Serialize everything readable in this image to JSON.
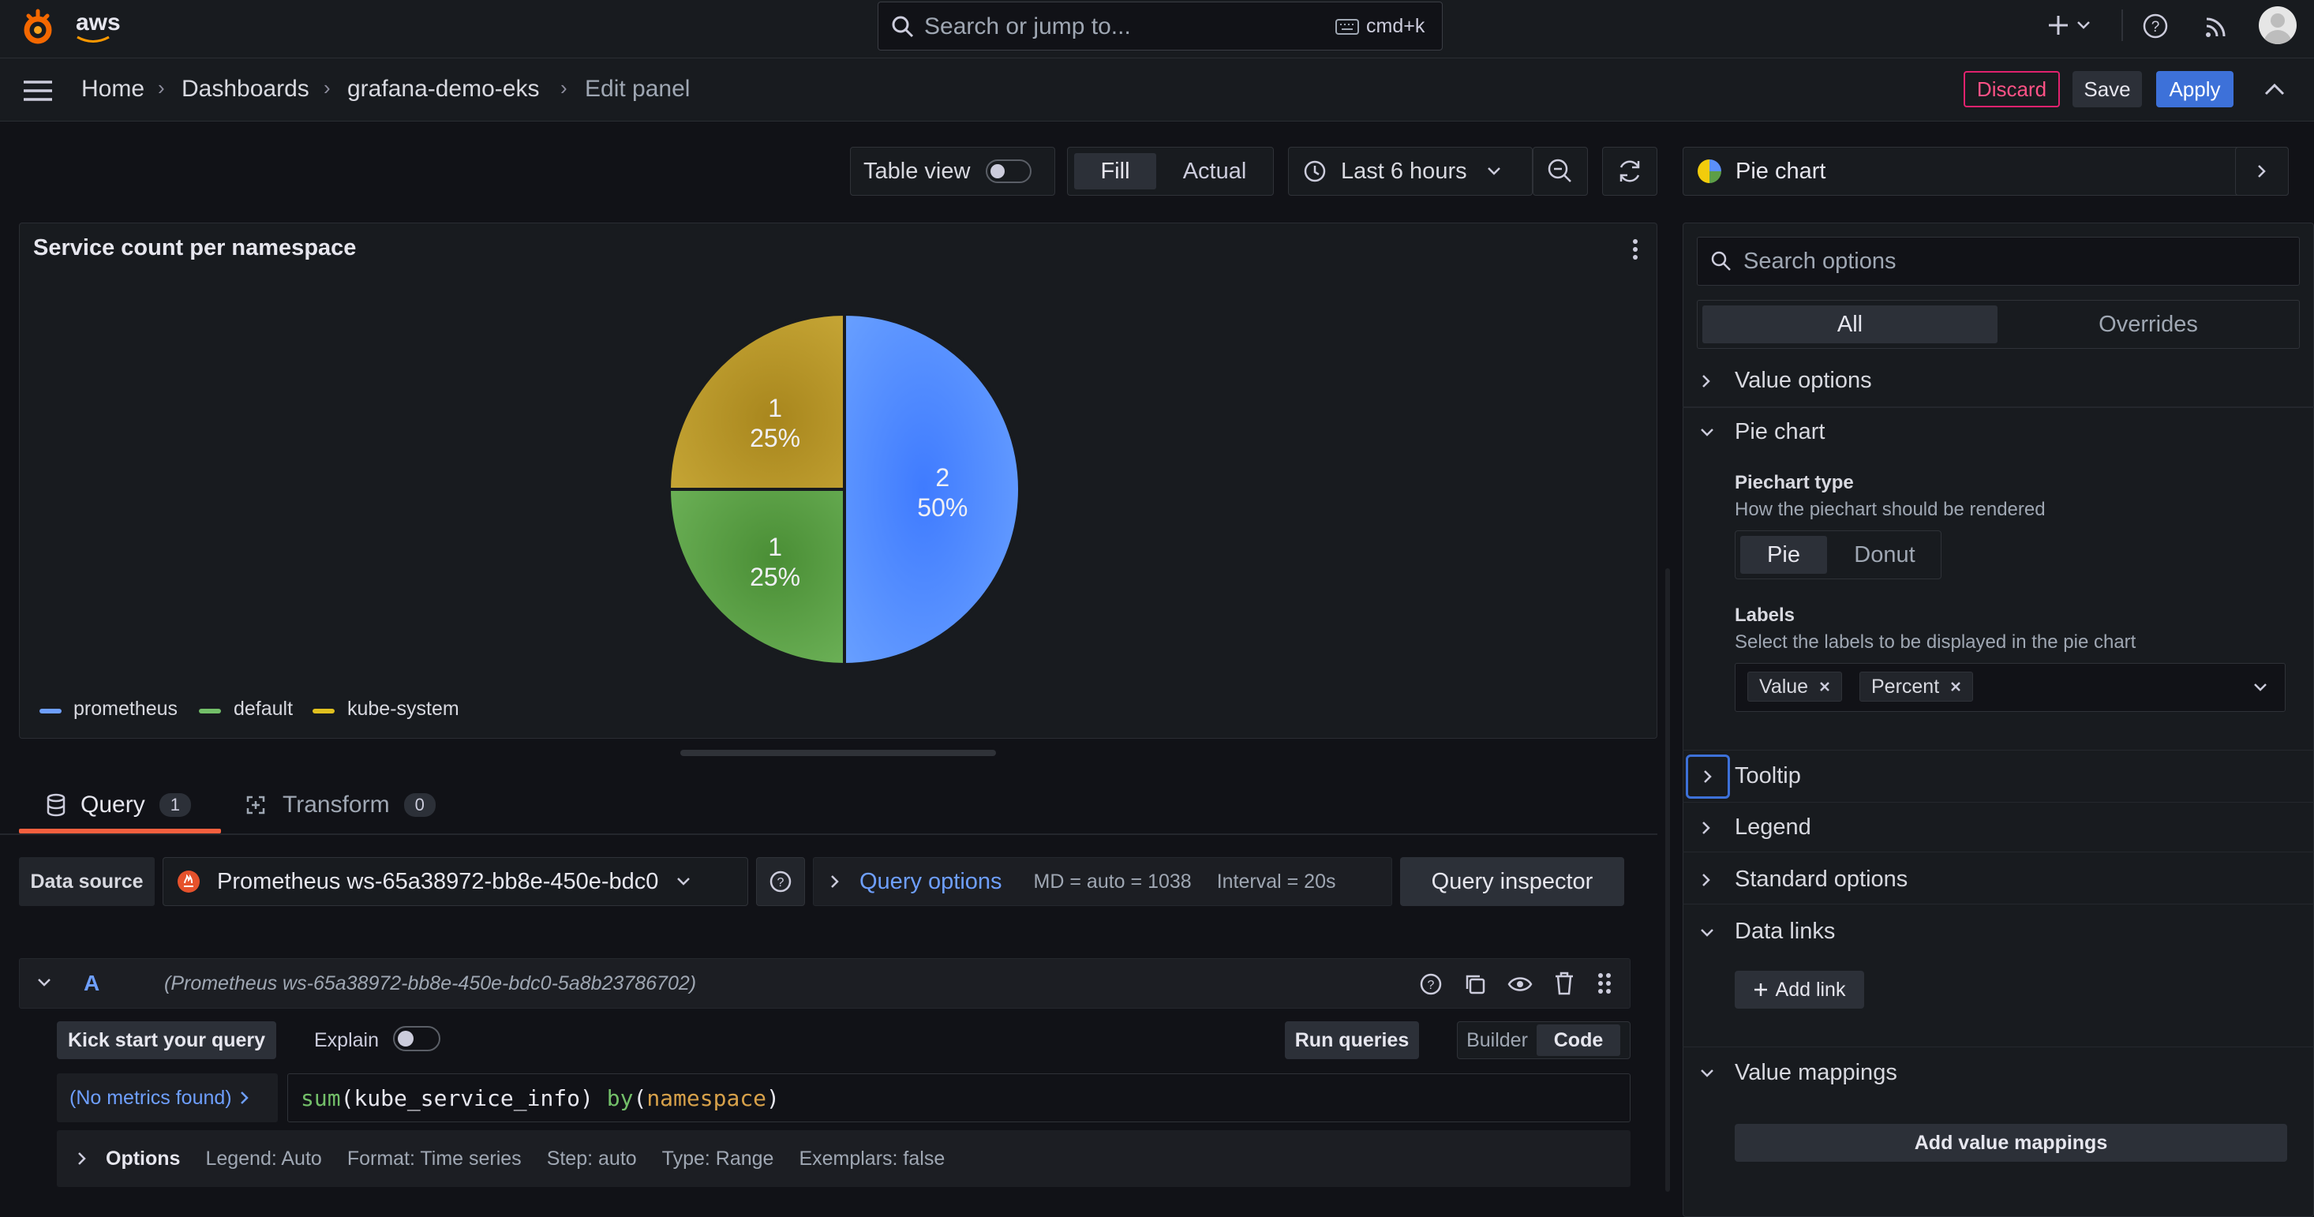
{
  "topbar": {
    "brand": "aws",
    "search_placeholder": "Search or jump to...",
    "search_shortcut": "cmd+k",
    "icons": [
      "plus-icon",
      "chevron-down-icon",
      "help-icon",
      "rss-icon",
      "avatar"
    ]
  },
  "breadcrumb": {
    "items": [
      "Home",
      "Dashboards",
      "grafana-demo-eks"
    ],
    "current": "Edit panel"
  },
  "actions": {
    "discard": "Discard",
    "save": "Save",
    "apply": "Apply"
  },
  "toolbar": {
    "table_view": "Table view",
    "fill": "Fill",
    "actual": "Actual",
    "time_range": "Last 6 hours"
  },
  "panel": {
    "title": "Service count per namespace",
    "legend": [
      {
        "label": "prometheus",
        "color": "#6e9fff"
      },
      {
        "label": "default",
        "color": "#73bf69"
      },
      {
        "label": "kube-system",
        "color": "#e0c01f"
      }
    ]
  },
  "chart_data": {
    "type": "pie",
    "title": "Service count per namespace",
    "categories": [
      "prometheus",
      "default",
      "kube-system"
    ],
    "values": [
      2,
      1,
      1
    ],
    "percents": [
      "50%",
      "25%",
      "25%"
    ],
    "value_labels": [
      "2",
      "1",
      "1"
    ],
    "colors": [
      "#5b8ff9",
      "#5d9e47",
      "#c2a12c"
    ],
    "legend_placement": "bottom-left"
  },
  "tabs": [
    {
      "label": "Query",
      "count": "1"
    },
    {
      "label": "Transform",
      "count": "0"
    }
  ],
  "query": {
    "datasource_label": "Data source",
    "datasource": "Prometheus ws-65a38972-bb8e-450e-bdc0",
    "query_options": "Query options",
    "md": "MD = auto = 1038",
    "interval": "Interval = 20s",
    "inspector": "Query inspector",
    "row_letter": "A",
    "row_source": "(Prometheus ws-65a38972-bb8e-450e-bdc0-5a8b23786702)",
    "kick_start": "Kick start your query",
    "explain": "Explain",
    "run_queries": "Run queries",
    "builder": "Builder",
    "code": "Code",
    "no_metrics": "(No metrics found)",
    "expr_fn": "sum",
    "expr_metric": "kube_service_info",
    "expr_by": "by",
    "expr_label": "namespace",
    "options_label": "Options",
    "legend_opt": "Legend: Auto",
    "format_opt": "Format: Time series",
    "step_opt": "Step: auto",
    "type_opt": "Type: Range",
    "exemplars_opt": "Exemplars: false"
  },
  "options": {
    "viz": "Pie chart",
    "search_placeholder": "Search options",
    "tab_all": "All",
    "tab_overrides": "Overrides",
    "sections": {
      "value_options": "Value options",
      "pie_chart": "Pie chart",
      "tooltip": "Tooltip",
      "legend": "Legend",
      "standard_options": "Standard options",
      "data_links": "Data links",
      "value_mappings": "Value mappings"
    },
    "piechart_type_label": "Piechart type",
    "piechart_type_desc": "How the piechart should be rendered",
    "pie": "Pie",
    "donut": "Donut",
    "labels_label": "Labels",
    "labels_desc": "Select the labels to be displayed in the pie chart",
    "labels_tags": [
      "Value",
      "Percent"
    ],
    "add_link": "Add link",
    "add_value_mappings": "Add value mappings"
  }
}
